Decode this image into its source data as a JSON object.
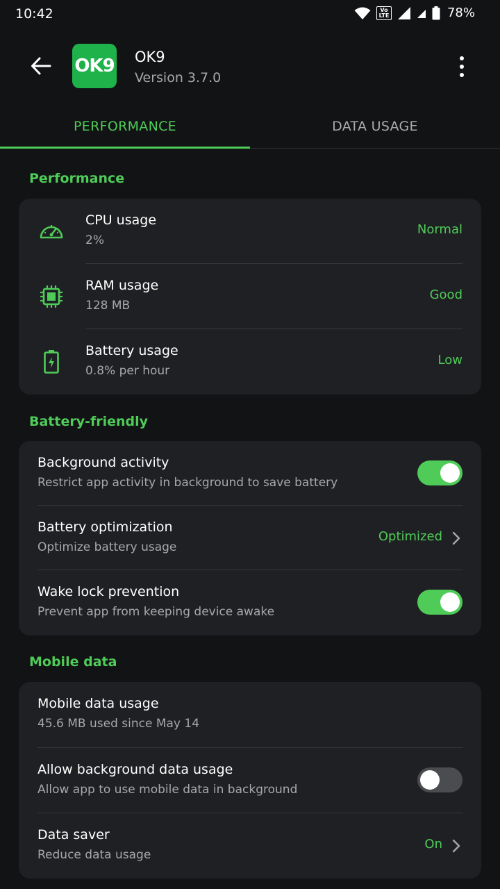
{
  "status_bar": {
    "time": "10:42",
    "battery_percent": "78%",
    "volte": "Vo LTE"
  },
  "app": {
    "logo_text": "OK9",
    "name": "OK9",
    "version": "Version 3.7.0"
  },
  "tabs": [
    {
      "label": "PERFORMANCE",
      "active": true
    },
    {
      "label": "DATA USAGE",
      "active": false
    }
  ],
  "performance": {
    "title": "Performance",
    "items": [
      {
        "icon": "speedometer-icon",
        "title": "CPU usage",
        "subtitle": "2%",
        "status": "Normal"
      },
      {
        "icon": "chip-icon",
        "title": "RAM usage",
        "subtitle": "128 MB",
        "status": "Good"
      },
      {
        "icon": "battery-charging-icon",
        "title": "Battery usage",
        "subtitle": "0.8% per hour",
        "status": "Low"
      }
    ]
  },
  "battery_friendly": {
    "title": "Battery-friendly",
    "items": [
      {
        "title": "Background activity",
        "subtitle": "Restrict app activity in background to save battery",
        "toggle": true
      },
      {
        "title": "Battery optimization",
        "subtitle": "Optimize battery usage",
        "value": "Optimized"
      },
      {
        "title": "Wake lock prevention",
        "subtitle": "Prevent app from keeping device awake",
        "toggle": true
      }
    ]
  },
  "mobile_data": {
    "title": "Mobile data",
    "items": [
      {
        "title": "Mobile data usage",
        "subtitle": "45.6 MB used since May 14"
      },
      {
        "title": "Allow background data usage",
        "subtitle": "Allow app to use mobile data in background",
        "toggle": false
      },
      {
        "title": "Data saver",
        "subtitle": "Reduce data usage",
        "value": "On"
      }
    ]
  },
  "colors": {
    "accent": "#4fcc58",
    "background": "#121315",
    "card": "#1f2023",
    "logo": "#1fb24a"
  }
}
